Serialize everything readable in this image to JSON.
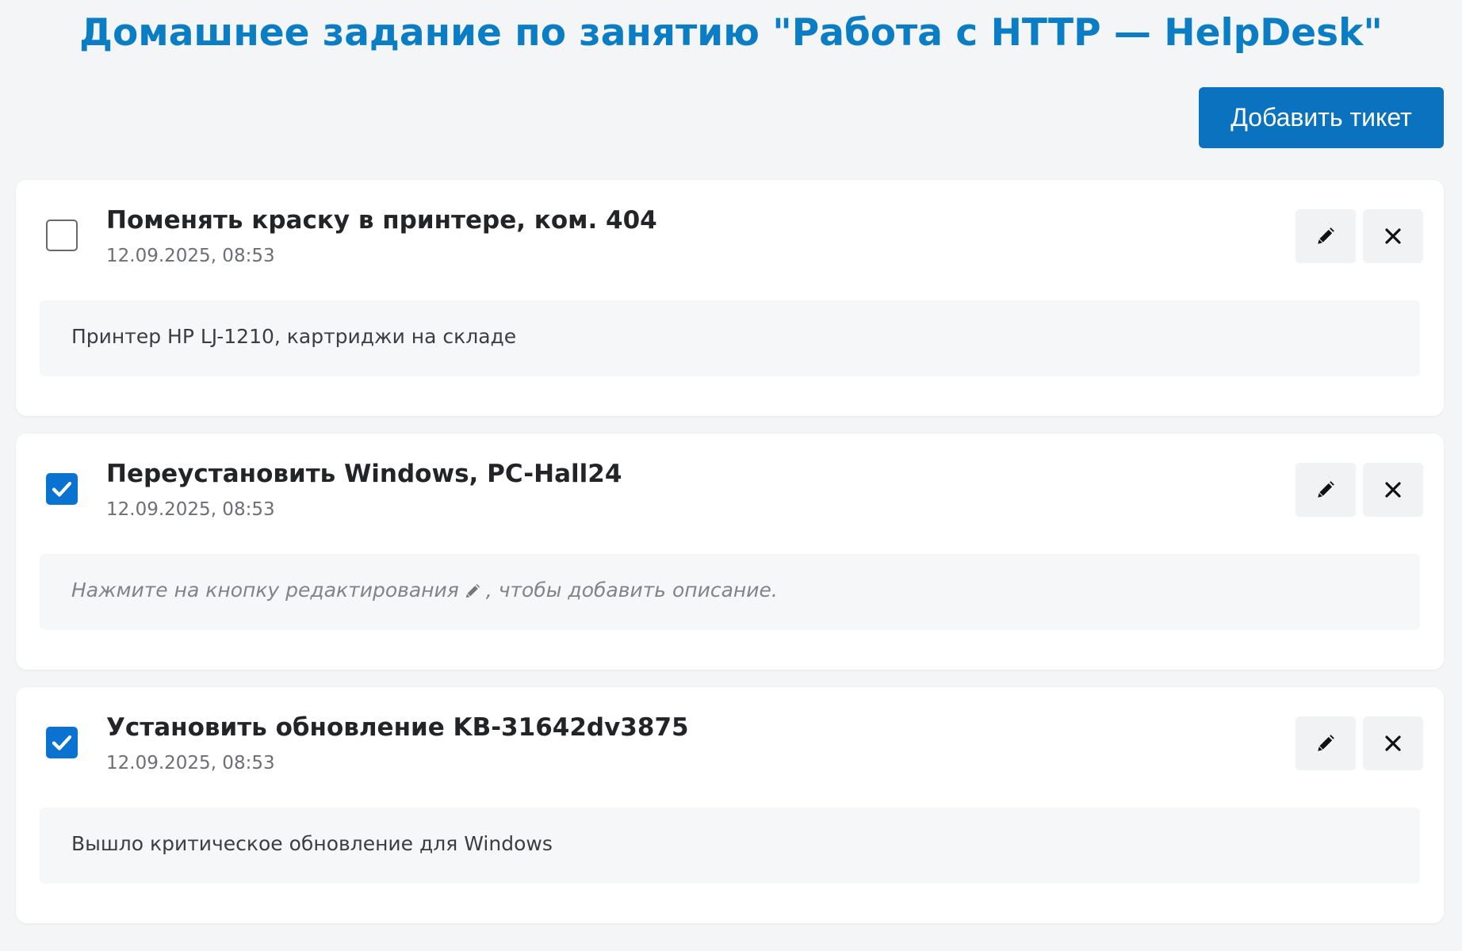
{
  "page": {
    "title": "Домашнее задание по занятию \"Работа с HTTP — HelpDesk\"",
    "add_button_label": "Добавить тикет"
  },
  "colors": {
    "accent": "#0a7dc4",
    "button": "#0a72be",
    "checkbox_checked": "#0a72d0"
  },
  "icons": {
    "edit": "pencil-icon",
    "delete": "close-icon",
    "checked": "checkmark-icon"
  },
  "tickets": [
    {
      "name": "Поменять краску в принтере, ком. 404",
      "created": "12.09.2025, 08:53",
      "done": false,
      "description": "Принтер HP LJ-1210, картриджи на складе"
    },
    {
      "name": "Переустановить Windows, PC-Hall24",
      "created": "12.09.2025, 08:53",
      "done": true,
      "description": "",
      "placeholder_before": "Нажмите на кнопку редактирования",
      "placeholder_after": ", чтобы добавить описание."
    },
    {
      "name": "Установить обновление KB-31642dv3875",
      "created": "12.09.2025, 08:53",
      "done": true,
      "description": "Вышло критическое обновление для Windows"
    }
  ]
}
